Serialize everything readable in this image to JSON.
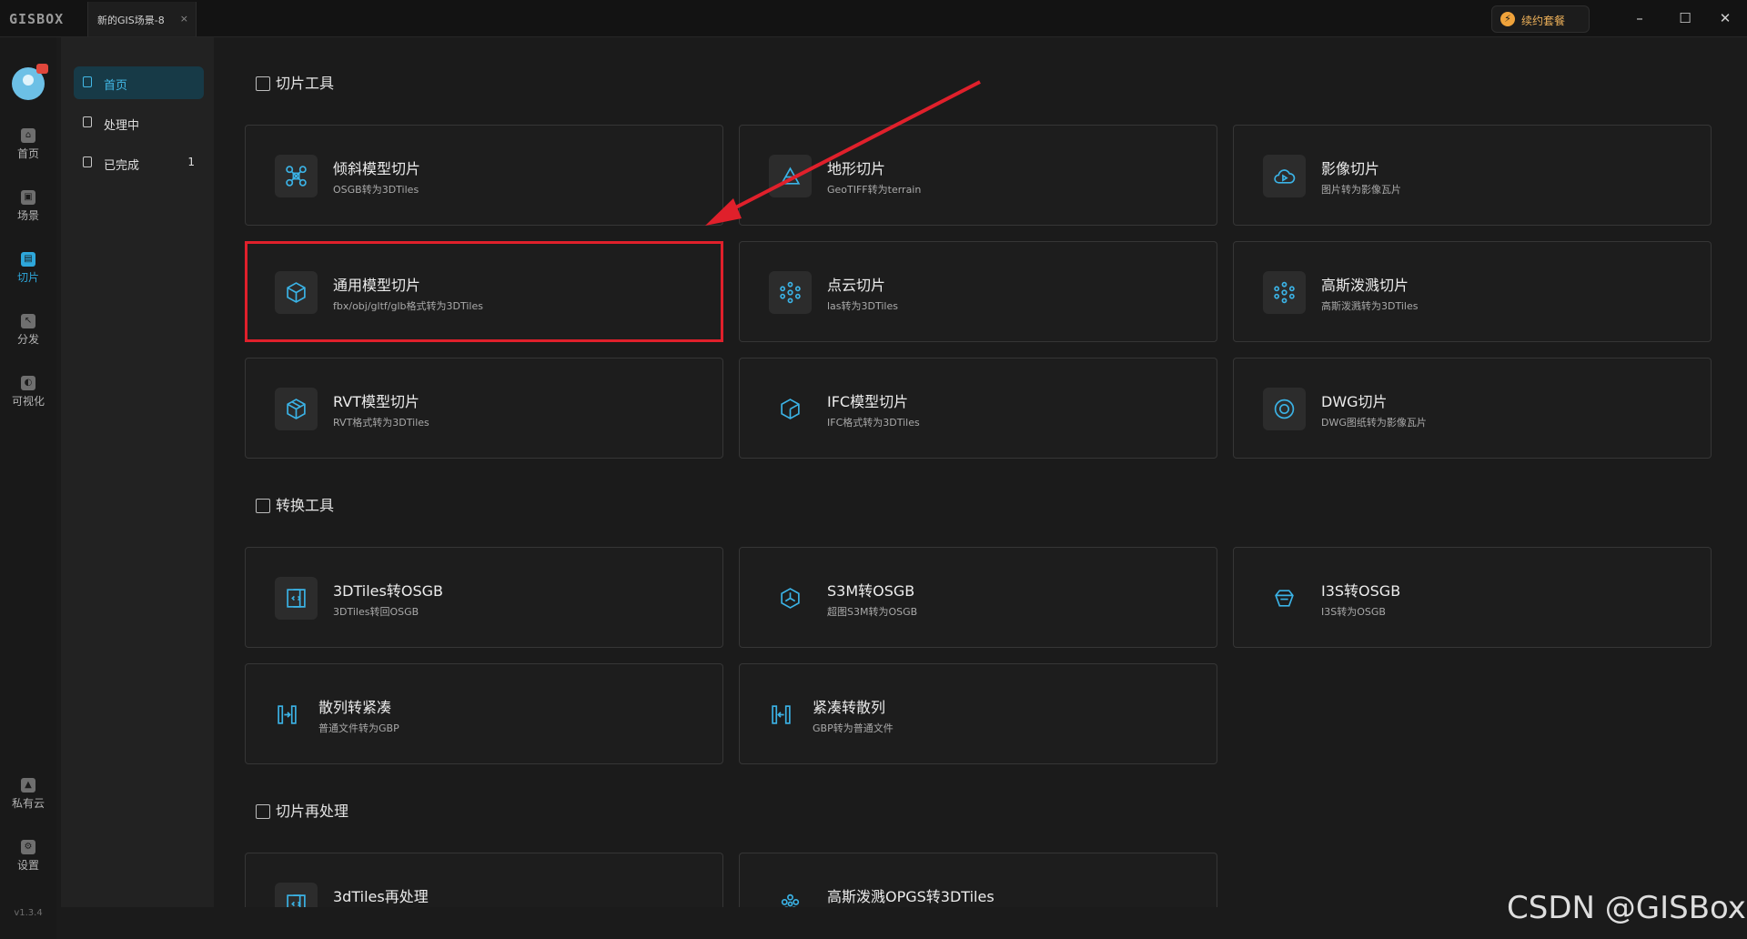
{
  "titlebar": {
    "logo": "GISBOX",
    "tab_title": "新的GIS场景-8",
    "tab_close": "×",
    "renew_label": "续约套餐",
    "renew_icon": "lightning-icon",
    "minimize": "–",
    "maximize": "☐",
    "close": "✕"
  },
  "rail": {
    "top_items": [
      {
        "label": "首页",
        "icon": "home-icon"
      },
      {
        "label": "场景",
        "icon": "cube-icon"
      },
      {
        "label": "切片",
        "icon": "slice-icon"
      },
      {
        "label": "分发",
        "icon": "distribute-icon"
      },
      {
        "label": "可视化",
        "icon": "visual-icon"
      }
    ],
    "bottom_items": [
      {
        "label": "私有云",
        "icon": "lock-icon"
      },
      {
        "label": "设置",
        "icon": "gear-icon"
      }
    ],
    "version": "v1.3.4",
    "active": "切片"
  },
  "submenu": {
    "items": [
      {
        "label": "首页",
        "count": ""
      },
      {
        "label": "处理中",
        "count": ""
      },
      {
        "label": "已完成",
        "count": "1"
      }
    ],
    "active": "首页"
  },
  "sections": {
    "slice_tools": "切片工具",
    "convert_tools": "转换工具",
    "reprocess": "切片再处理"
  },
  "cards": {
    "oblique": {
      "title": "倾斜模型切片",
      "desc": "OSGB转为3DTiles",
      "icon": "drone-icon"
    },
    "terrain": {
      "title": "地形切片",
      "desc": "GeoTIFF转为terrain",
      "icon": "terrain-icon"
    },
    "imagery": {
      "title": "影像切片",
      "desc": "图片转为影像瓦片",
      "icon": "cloud-play-icon"
    },
    "general": {
      "title": "通用模型切片",
      "desc": "fbx/obj/gltf/glb格式转为3DTiles",
      "icon": "box-icon"
    },
    "pointcloud": {
      "title": "点云切片",
      "desc": "las转为3DTiles",
      "icon": "point-cloud-icon"
    },
    "gaussian": {
      "title": "高斯泼溅切片",
      "desc": "高斯泼溅转为3DTiles",
      "icon": "gaussian-icon"
    },
    "rvt": {
      "title": "RVT模型切片",
      "desc": "RVT格式转为3DTiles",
      "icon": "rvt-box-icon"
    },
    "ifc": {
      "title": "IFC模型切片",
      "desc": "IFC格式转为3DTiles",
      "icon": "ifc-cube-icon"
    },
    "dwg": {
      "title": "DWG切片",
      "desc": "DWG图纸转为影像瓦片",
      "icon": "dwg-circle-icon"
    },
    "tiles2osgb": {
      "title": "3DTiles转OSGB",
      "desc": "3DTiles转回OSGB",
      "icon": "swap-doc-icon"
    },
    "s3m2osgb": {
      "title": "S3M转OSGB",
      "desc": "超图S3M转为OSGB",
      "icon": "hex-node-icon"
    },
    "i3s2osgb": {
      "title": "I3S转OSGB",
      "desc": "I3S转为OSGB",
      "icon": "i3s-icon"
    },
    "scatter2compact": {
      "title": "散列转紧凑",
      "desc": "普通文件转为GBP",
      "icon": "split-arrows-icon"
    },
    "compact2scatter": {
      "title": "紧凑转散列",
      "desc": "GBP转为普通文件",
      "icon": "merge-arrows-icon"
    },
    "tiles_reprocess": {
      "title": "3dTiles再处理",
      "desc": "",
      "icon": "swap-doc-icon"
    },
    "gauss_opgs": {
      "title": "高斯泼溅OPGS转3DTiles",
      "desc": "",
      "icon": "flower-icon"
    }
  },
  "colors": {
    "accent": "#2ea7db",
    "highlight": "#e0202b",
    "renew": "#efb25a"
  },
  "watermark": "CSDN @GISBox"
}
